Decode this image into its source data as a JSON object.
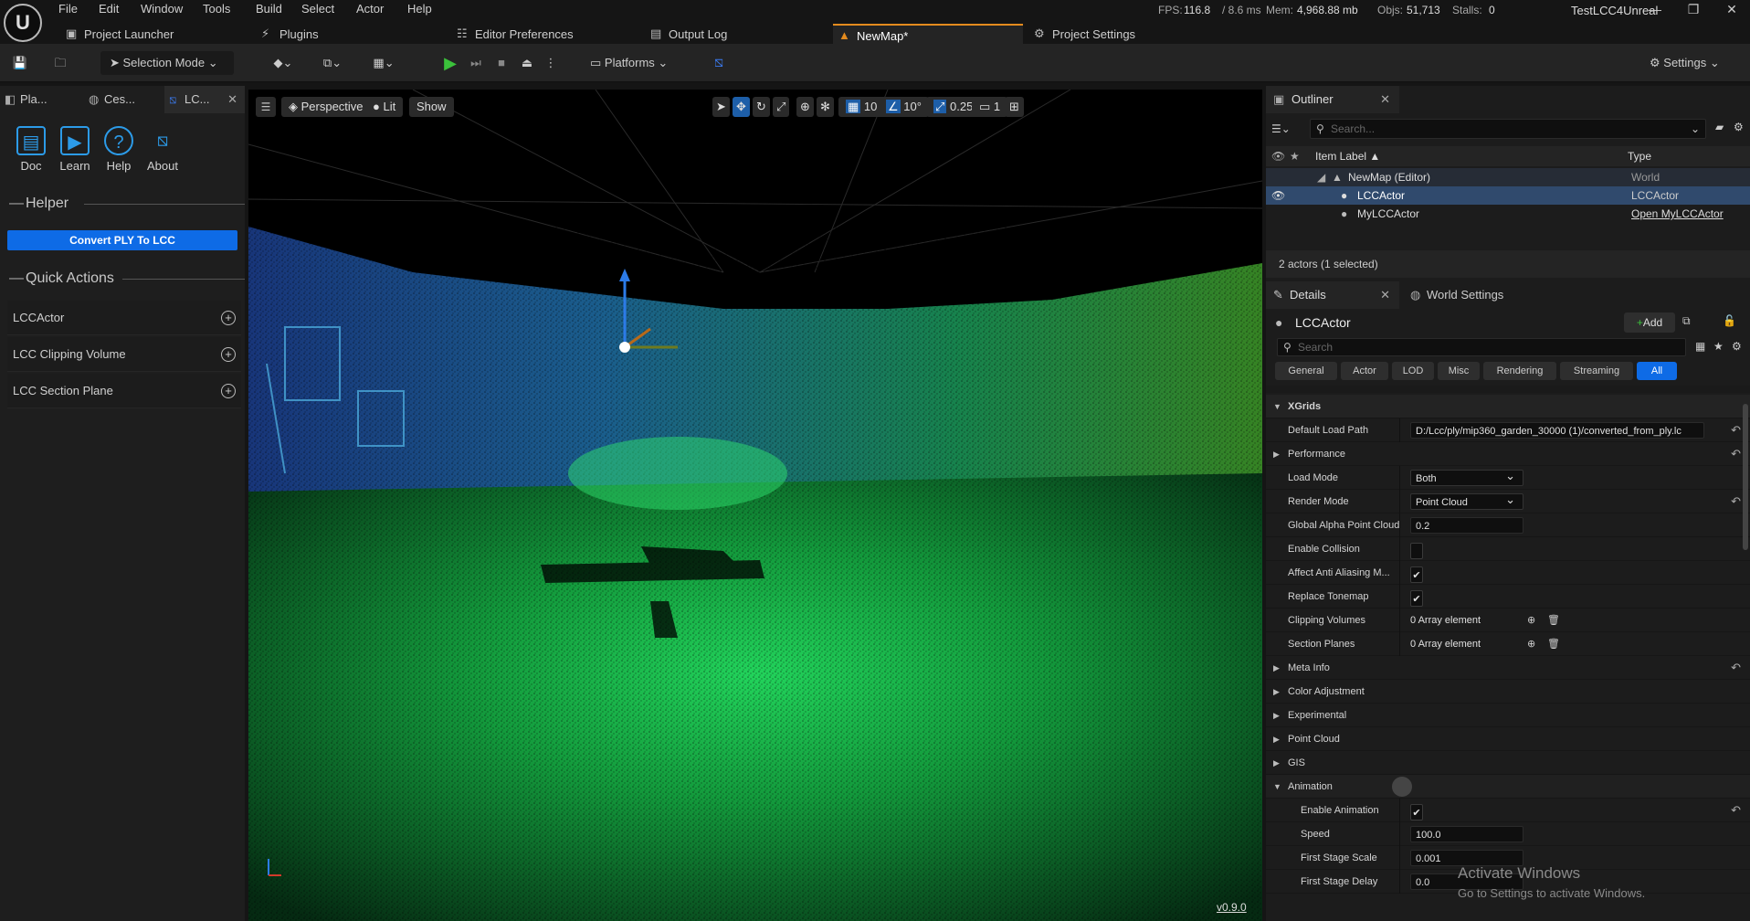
{
  "menu": [
    "File",
    "Edit",
    "Window",
    "Tools",
    "Build",
    "Select",
    "Actor",
    "Help"
  ],
  "stats": {
    "fps_label": "FPS:",
    "fps": "116.8",
    "ms": "/ 8.6 ms",
    "mem_label": "Mem:",
    "mem": "4,968.88 mb",
    "objs_label": "Objs:",
    "objs": "51,713",
    "stalls_label": "Stalls:",
    "stalls": "0"
  },
  "project_name": "TestLCC4Unreal",
  "tabs": [
    "Project Launcher",
    "Plugins",
    "Editor Preferences",
    "Output Log",
    "NewMap*",
    "Project Settings"
  ],
  "toolbar": {
    "selection_mode": "Selection Mode",
    "platforms": "Platforms",
    "settings": "Settings"
  },
  "left": {
    "tabs": [
      "Pla...",
      "Ces...",
      "LC..."
    ],
    "cards": [
      "Doc",
      "Learn",
      "Help",
      "About"
    ],
    "helper_title": "Helper",
    "convert_button": "Convert PLY To LCC",
    "quick_actions_title": "Quick Actions",
    "quick_actions": [
      "LCCActor",
      "LCC Clipping Volume",
      "LCC Section Plane"
    ]
  },
  "viewport": {
    "perspective": "Perspective",
    "lit": "Lit",
    "show": "Show",
    "grid": "10",
    "angle": "10°",
    "scale": "0.25",
    "camera": "1",
    "version": "v0.9.0"
  },
  "outliner": {
    "title": "Outliner",
    "search_placeholder": "Search...",
    "col_label": "Item Label ▲",
    "col_type": "Type",
    "rows": [
      {
        "label": "NewMap (Editor)",
        "type": "World"
      },
      {
        "label": "LCCActor",
        "type": "LCCActor"
      },
      {
        "label": "MyLCCActor",
        "type": "Open MyLCCActor"
      }
    ],
    "count": "2 actors (1 selected)"
  },
  "details": {
    "tab": "Details",
    "world_settings": "World Settings",
    "actor_name": "LCCActor",
    "add": "Add",
    "search_placeholder": "Search",
    "filters": [
      "General",
      "Actor",
      "LOD",
      "Misc",
      "Rendering",
      "Streaming",
      "All"
    ],
    "section": "XGrids",
    "default_load_path_label": "Default Load Path",
    "default_load_path": "D:/Lcc/ply/mip360_garden_30000 (1)/converted_from_ply.lc",
    "performance": "Performance",
    "load_mode_label": "Load Mode",
    "load_mode": "Both",
    "render_mode_label": "Render Mode",
    "render_mode": "Point Cloud",
    "alpha_label": "Global Alpha Point Cloud",
    "alpha": "0.2",
    "collision_label": "Enable Collision",
    "aa_label": "Affect Anti Aliasing M...",
    "tonemap_label": "Replace Tonemap",
    "clipping_label": "Clipping Volumes",
    "clipping_val": "0 Array element",
    "section_label": "Section Planes",
    "section_val": "0 Array element",
    "collapsed": [
      "Meta Info",
      "Color Adjustment",
      "Experimental",
      "Point Cloud",
      "GIS"
    ],
    "animation": "Animation",
    "enable_anim_label": "Enable Animation",
    "speed_label": "Speed",
    "speed": "100.0",
    "fss_label": "First Stage Scale",
    "fss": "0.001",
    "fsd_label": "First Stage Delay",
    "fsd": "0.0"
  },
  "watermark": {
    "line1": "Activate Windows",
    "line2": "Go to Settings to activate Windows."
  },
  "colors": {
    "accent_blue": "#0e6be6",
    "selection": "#304a6d",
    "tab_orange": "#e48b1e"
  }
}
